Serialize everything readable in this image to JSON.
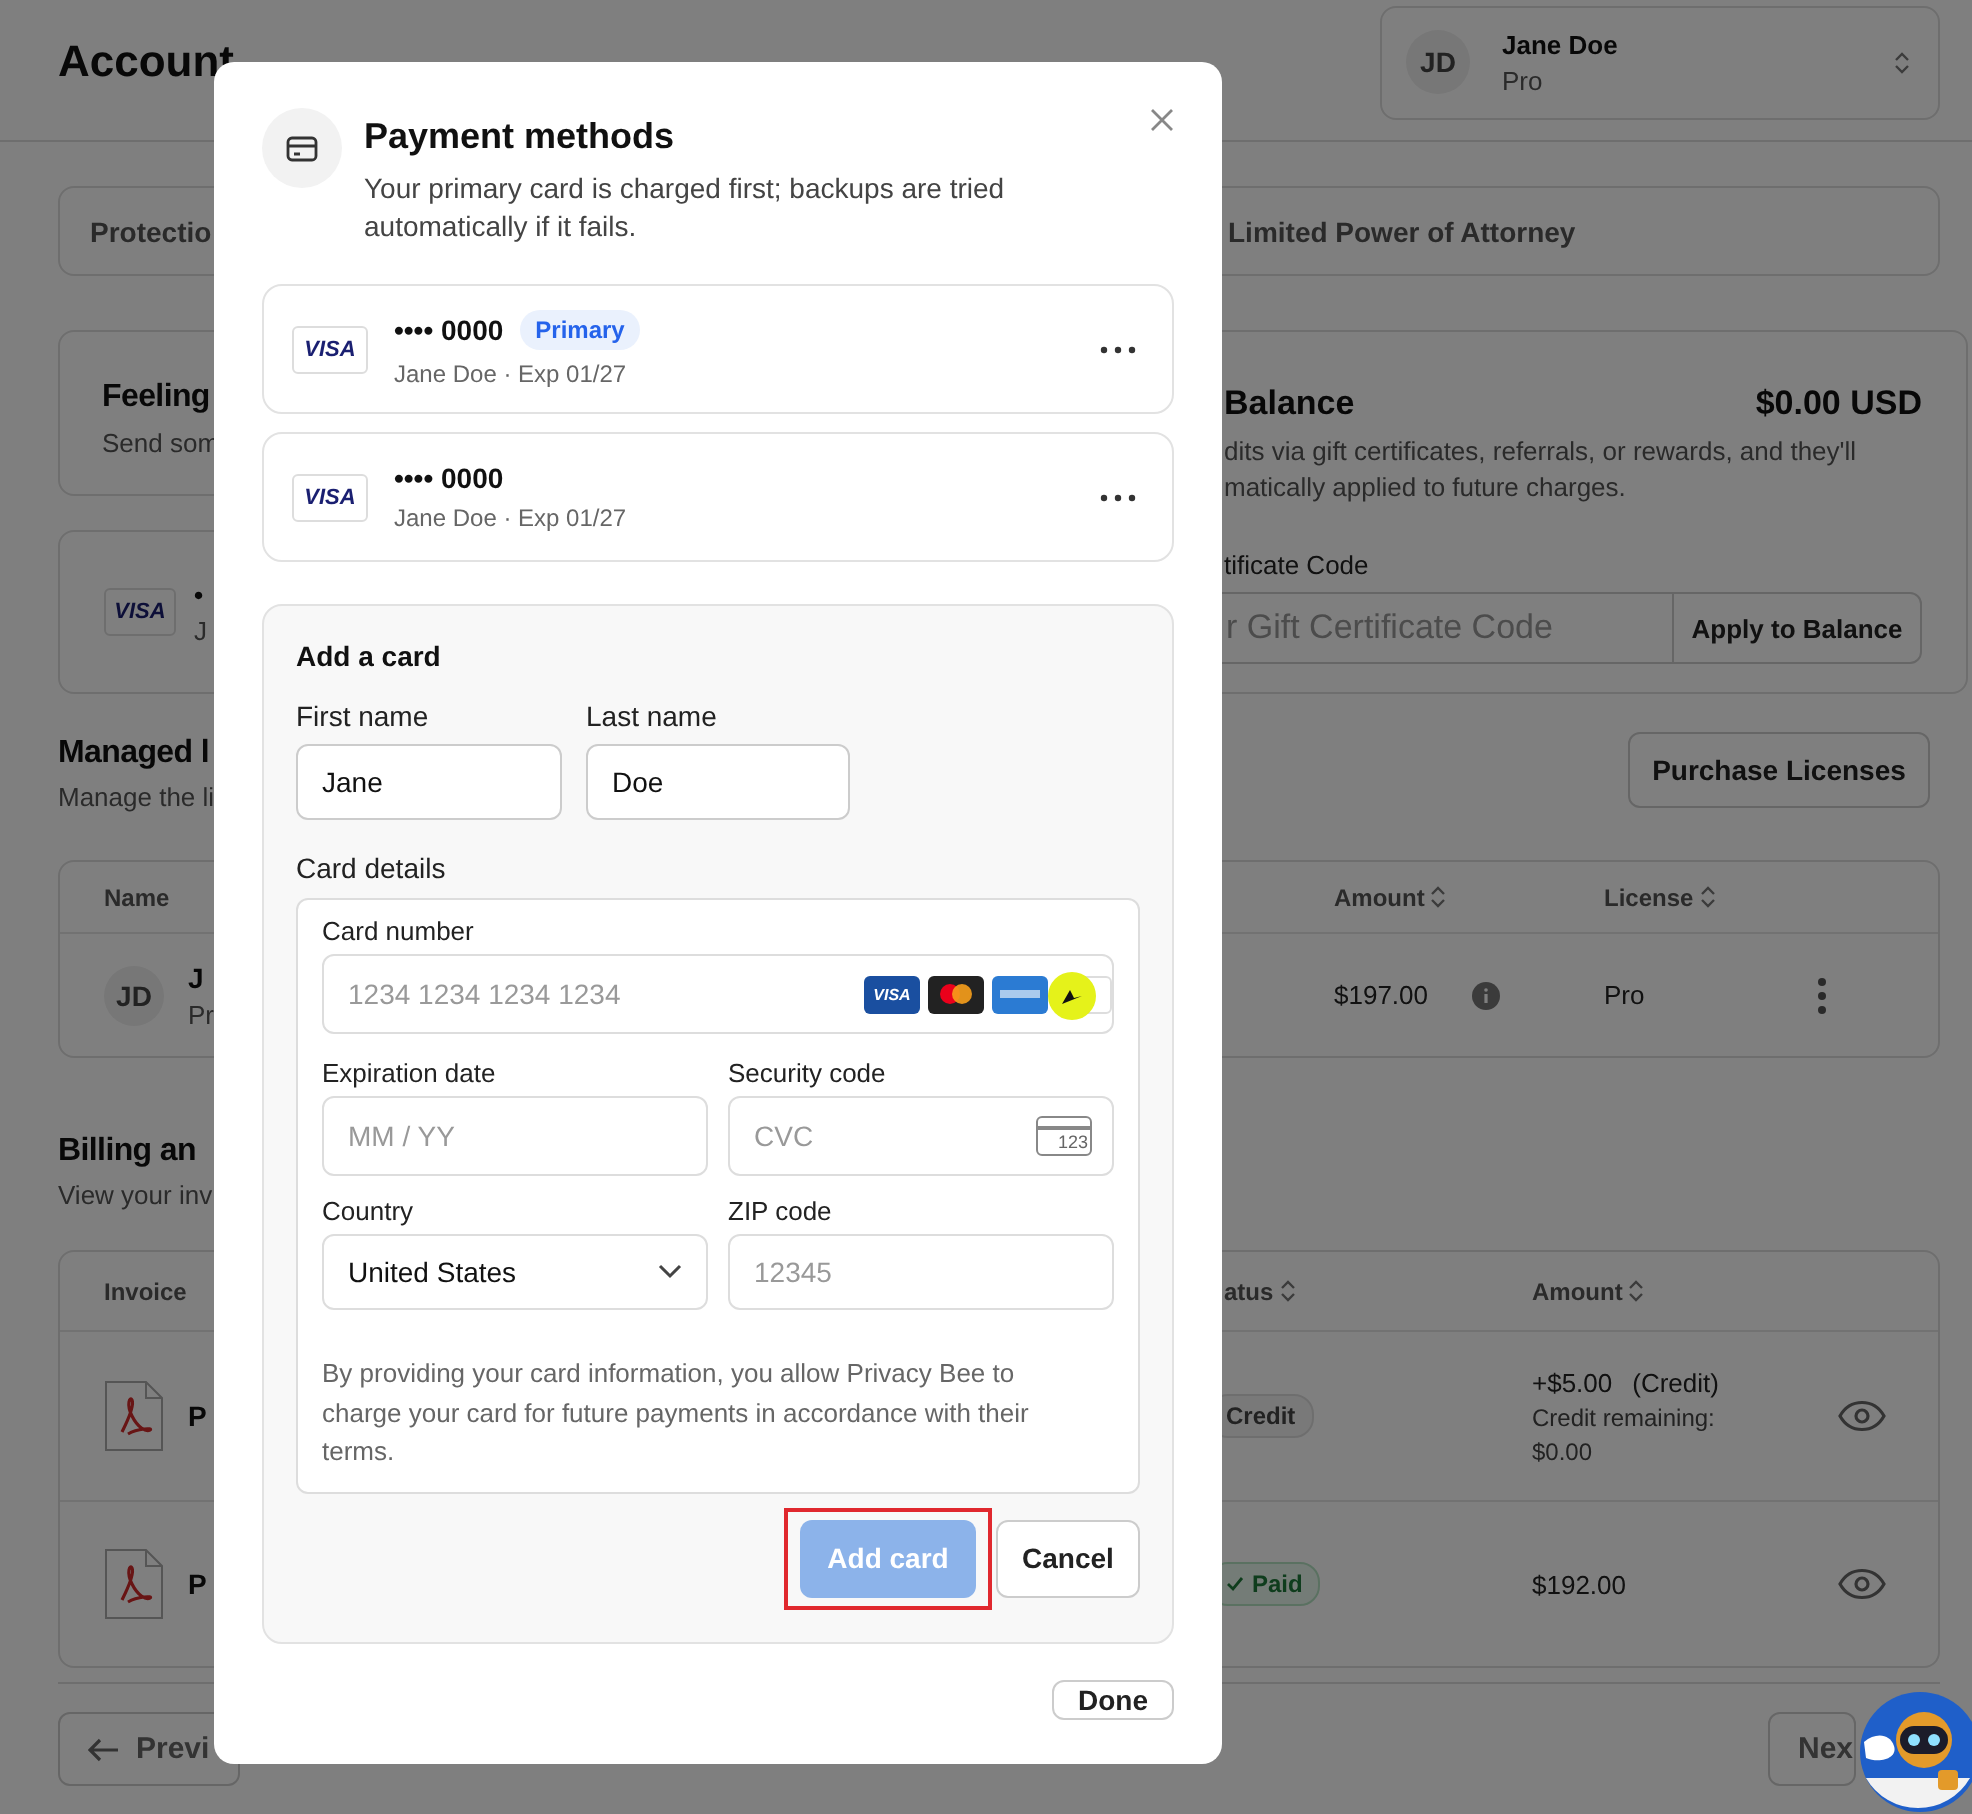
{
  "page": {
    "title": "Account"
  },
  "account": {
    "initials": "JD",
    "name": "Jane Doe",
    "plan": "Pro"
  },
  "tabs": [
    {
      "label": "Protectio"
    },
    {
      "label": "Limited Power of Attorney"
    }
  ],
  "feeling_card": {
    "title": "Feeling",
    "text": "Send som"
  },
  "payment_card": {
    "brand": "VISA",
    "dots": "•",
    "text": "J"
  },
  "balance_card": {
    "title": "Balance",
    "amount": "$0.00 USD",
    "description": [
      "dits via gift certificates, referrals, or rewards, and they'll",
      "matically applied to future charges."
    ],
    "code_label": "tificate Code",
    "code_placeholder": "r Gift Certificate Code",
    "apply_button": "Apply to Balance"
  },
  "licenses": {
    "title": "Managed l",
    "subtitle": "Manage the li",
    "button": "Purchase Licenses",
    "columns": [
      {
        "label": "Name",
        "sortable": false
      },
      {
        "label": "Amount",
        "sortable": true
      },
      {
        "label": "License",
        "sortable": true
      }
    ],
    "rows": [
      {
        "initials": "JD",
        "name": "J",
        "plan": "Pr",
        "amount": "$197.00",
        "license": "Pro"
      }
    ]
  },
  "billing": {
    "title": "Billing an",
    "subtitle": "View your inv",
    "columns": [
      {
        "label": "Invoice",
        "sortable": false
      },
      {
        "label": "atus",
        "sortable": true
      },
      {
        "label": "Amount",
        "sortable": true
      }
    ],
    "rows": [
      {
        "invoice": "P",
        "status": "Credit",
        "kind": "credit",
        "amount": "+$5.00",
        "amount_note": "(Credit)",
        "remaining": [
          "Credit remaining:",
          "$0.00"
        ]
      },
      {
        "invoice": "P",
        "status": "Paid",
        "kind": "paid",
        "amount": "$192.00"
      }
    ]
  },
  "pagination": {
    "previous": "Previ",
    "next": "Nex"
  },
  "modal": {
    "title": "Payment methods",
    "subtitle": "Your primary card is charged first; backups are tried automatically if it fails.",
    "cards": [
      {
        "brand": "VISA",
        "number": "•••• 0000",
        "badge": "Primary",
        "details": "Jane Doe · Exp 01/27"
      },
      {
        "brand": "VISA",
        "number": "•••• 0000",
        "details": "Jane Doe · Exp 01/27"
      }
    ],
    "add_card": {
      "title": "Add a card",
      "first_name": {
        "label": "First name",
        "value": "Jane"
      },
      "last_name": {
        "label": "Last name",
        "value": "Doe"
      },
      "details_label": "Card details",
      "card_number": {
        "label": "Card number",
        "placeholder": "1234 1234 1234 1234",
        "brands": [
          {
            "kind": "visa",
            "text": "VISA"
          },
          {
            "kind": "mastercard"
          },
          {
            "kind": "amex"
          },
          {
            "kind": "discover"
          }
        ]
      },
      "expiry": {
        "label": "Expiration date",
        "placeholder": "MM / YY"
      },
      "security": {
        "label": "Security code",
        "placeholder": "CVC",
        "hint": "123"
      },
      "country": {
        "label": "Country",
        "value": "United States"
      },
      "zip": {
        "label": "ZIP code",
        "placeholder": "12345"
      },
      "disclaimer": "By providing your card information, you allow Privacy Bee to charge your card for future payments in accordance with their terms.",
      "submit": {
        "label": "Add card",
        "disabled": true,
        "highlighted": true
      },
      "cancel": "Cancel"
    },
    "done": "Done"
  }
}
